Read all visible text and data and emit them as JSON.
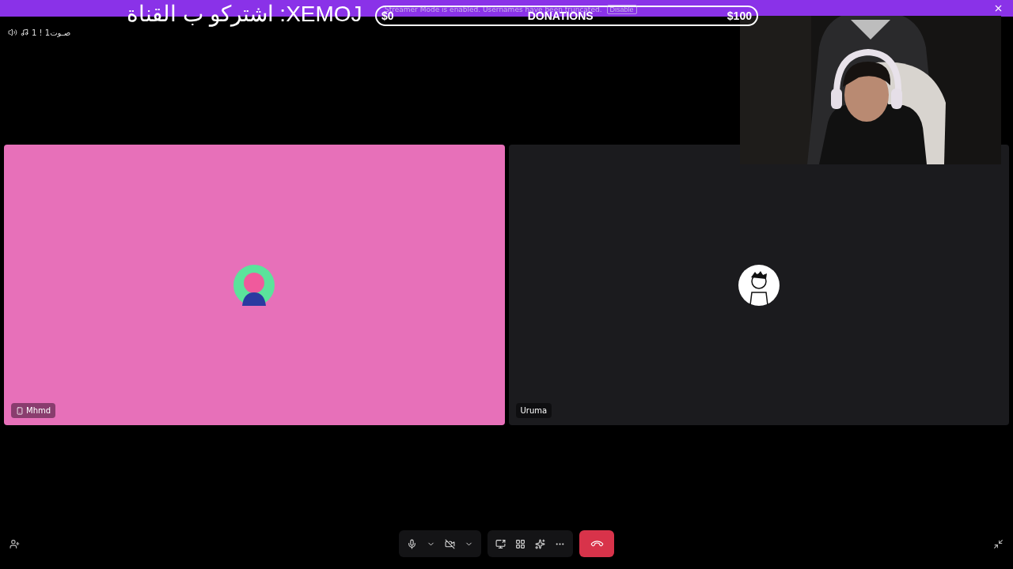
{
  "overlay": {
    "subscribe_text": "XEMOJ: اشتركو ب القناة",
    "donations": {
      "min": "$0",
      "label": "DONATIONS",
      "max": "$100"
    }
  },
  "streamer_notice": {
    "text": "Streamer Mode is enabled. Usernames have been truncated.",
    "button": "Disable"
  },
  "channel": {
    "name": "صـوت1 ! 1"
  },
  "participants": [
    {
      "name": "Mhmd",
      "on_mobile": true,
      "color": "#e770b9"
    },
    {
      "name": "Uruma",
      "on_mobile": false,
      "color": "#1b1b1e"
    }
  ],
  "controls": {
    "mic_muted": false,
    "video_off": true
  }
}
